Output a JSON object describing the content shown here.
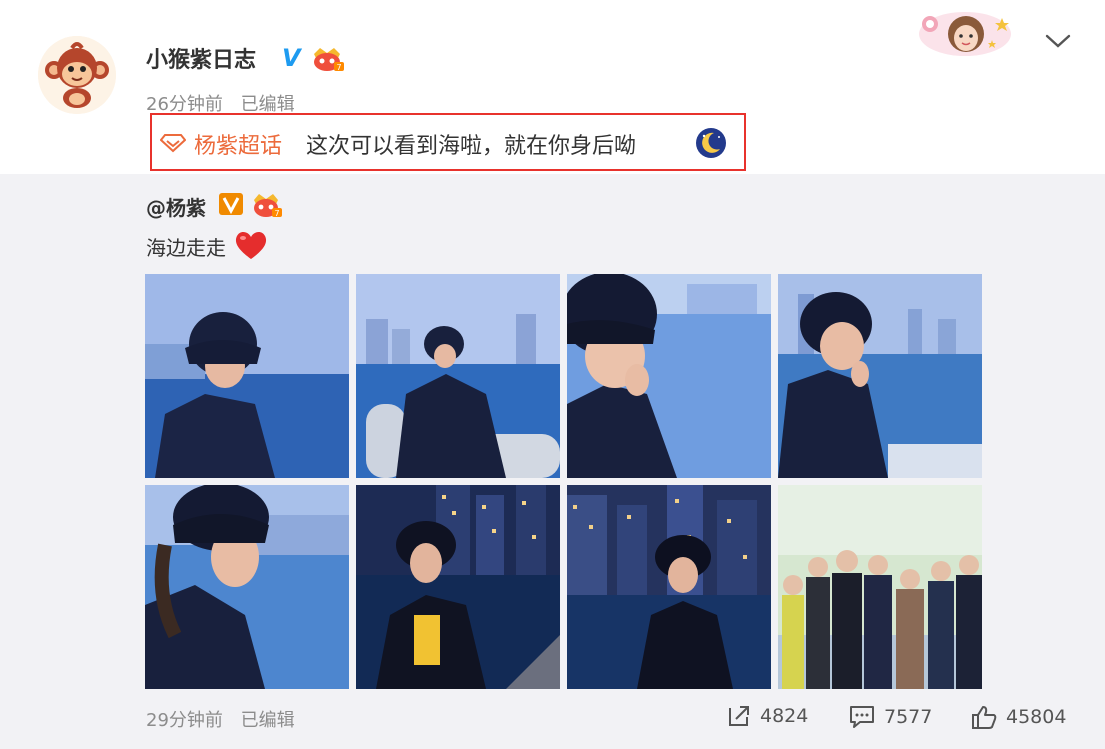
{
  "post": {
    "username": "小猴紫日志",
    "vip_mark": "V",
    "time": "26分钟前",
    "edited": "已编辑",
    "topic_link": "杨紫超话",
    "text": "这次可以看到海啦，就在你身后呦"
  },
  "original": {
    "username": "@杨紫",
    "text": "海边走走",
    "photos": [
      {
        "subject": "woman-in-bucket-hat-by-sea"
      },
      {
        "subject": "woman-leaning-on-railing-city-skyline"
      },
      {
        "subject": "woman-hand-on-chin-closeup"
      },
      {
        "subject": "woman-hand-on-chin-by-sea"
      },
      {
        "subject": "woman-profile-by-sea"
      },
      {
        "subject": "woman-night-city-yellow-sweater"
      },
      {
        "subject": "woman-night-waterfront"
      },
      {
        "subject": "group-photo-waterfront"
      }
    ],
    "time": "29分钟前",
    "edited": "已编辑",
    "shares": "4824",
    "comments": "7577",
    "likes": "45804"
  },
  "colors": {
    "topic": "#ec6b3c",
    "highlight_box": "#e8322c",
    "verified": "#1e9bf0",
    "repost_bg": "#f2f2f5"
  }
}
